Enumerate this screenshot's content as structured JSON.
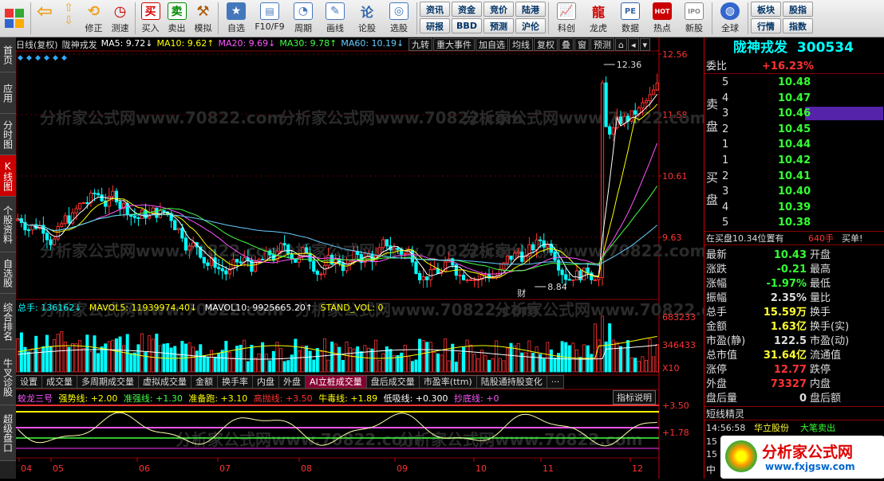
{
  "toolbar": {
    "buttons": [
      {
        "label": "",
        "icon": "back-icon",
        "color": "#f0a020"
      },
      {
        "label": "买入",
        "icon": "buy-icon",
        "color": "#d00",
        "glyph": "买"
      },
      {
        "label": "卖出",
        "icon": "sell-icon",
        "color": "#080",
        "glyph": "卖"
      },
      {
        "label": "模拟",
        "icon": "hammer-icon",
        "color": "#a50"
      },
      {
        "label": "自选",
        "icon": "star-icon",
        "color": "#36a"
      },
      {
        "label": "F10/F9",
        "icon": "f10-icon",
        "color": "#36a"
      },
      {
        "label": "周期",
        "icon": "period-icon",
        "color": "#36a"
      },
      {
        "label": "画线",
        "icon": "pencil-icon",
        "color": "#36a"
      },
      {
        "label": "论股",
        "icon": "discuss-icon",
        "color": "#36a"
      },
      {
        "label": "选股",
        "icon": "select-icon",
        "color": "#36a"
      }
    ],
    "updown": {
      "up_label": "修正",
      "down_label": "测速"
    },
    "pair_buttons": [
      [
        "资讯",
        "研报"
      ],
      [
        "资金",
        "BBD"
      ],
      [
        "竞价",
        "预测"
      ],
      [
        "陆港",
        "沪伦"
      ]
    ],
    "right_buttons": [
      {
        "label": "科创",
        "icon": "chart-icon"
      },
      {
        "label": "龙虎",
        "icon": "dragon-icon"
      },
      {
        "label": "数据",
        "icon": "pe-icon",
        "glyph": "PE"
      },
      {
        "label": "热点",
        "icon": "hot-icon",
        "glyph": "HOT"
      },
      {
        "label": "新股",
        "icon": "ipo-icon",
        "glyph": "IPO"
      },
      {
        "label": "全球",
        "icon": "globe-icon"
      }
    ],
    "far_right": [
      [
        "板块",
        "股指"
      ],
      [
        "行情",
        "指数"
      ]
    ]
  },
  "left_tabs": [
    "首页",
    "应用",
    "分时图",
    "K线图",
    "个股资料",
    "自选股",
    "综合排名",
    "牛叉诊股",
    "超级盘口"
  ],
  "left_tab_active": 3,
  "kline": {
    "period_label": "日线(复权)",
    "stock_name": "陇神戎发",
    "ma5": "MA5: 9.72↓",
    "ma10": "MA10: 9.62↑",
    "ma20": "MA20: 9.69↓",
    "ma30": "MA30: 9.78↑",
    "ma60": "MA60: 10.19↓",
    "buttons": [
      "九转",
      "重大事件",
      "加自选",
      "均线",
      "复权",
      "叠",
      "窗",
      "预测"
    ],
    "price_ticks": [
      "12.56",
      "11.58",
      "10.61",
      "9.63"
    ],
    "high_label": "12.36",
    "low_label": "8.84",
    "fin_label": "财",
    "watermark": "分析家公式网www.70822.com"
  },
  "volume": {
    "total": "总手: 136162↓",
    "mavol5": "MAVOL5: 11939974.40↓",
    "mavol10": "MAVOL10: 9925665.20↑",
    "standvol": "STAND_VOL: 0",
    "ticks": [
      "683233",
      "346433"
    ],
    "unit": "X10"
  },
  "indicator_tabs": [
    "设置",
    "成交量",
    "多周期成交量",
    "虚拟成交量",
    "金额",
    "换手率",
    "内盘",
    "外盘",
    "AI立桩成交量",
    "盘后成交量",
    "市盈率(ttm)",
    "陆股通持股变化",
    "···"
  ],
  "indicator_tab_active": 8,
  "indicator": {
    "name": "蛟龙三号",
    "strong": "强势线: +2.00",
    "quasi": "准强线: +1.30",
    "prep": "准备跑: +3.10",
    "high": "高抛线: +3.50",
    "bull": "牛毒线: +1.89",
    "low": "低吸线: +0.300",
    "bottom": "抄底线: +0",
    "button": "指标说明",
    "ticks": [
      "+3.50",
      "+1.78"
    ]
  },
  "months": [
    "04",
    "05",
    "06",
    "07",
    "08",
    "09",
    "10",
    "11",
    "12"
  ],
  "quote": {
    "name": "陇神戎发",
    "code": "300534",
    "weibi_label": "委比",
    "weibi_value": "+16.23%",
    "sell_label": [
      "卖",
      "盘"
    ],
    "buy_label": [
      "买",
      "盘"
    ],
    "sell": [
      {
        "lvl": "5",
        "price": "10.48"
      },
      {
        "lvl": "4",
        "price": "10.47"
      },
      {
        "lvl": "3",
        "price": "10.46"
      },
      {
        "lvl": "2",
        "price": "10.45"
      },
      {
        "lvl": "1",
        "price": "10.44"
      }
    ],
    "buy": [
      {
        "lvl": "1",
        "price": "10.42"
      },
      {
        "lvl": "2",
        "price": "10.41"
      },
      {
        "lvl": "3",
        "price": "10.40"
      },
      {
        "lvl": "4",
        "price": "10.39"
      },
      {
        "lvl": "5",
        "price": "10.38"
      }
    ],
    "position_text": "在买盘10.34位置有",
    "position_qty": "640手",
    "position_tag": "买单!",
    "stats": [
      {
        "l": "最新",
        "v": "10.43",
        "vc": "green",
        "r": "开盘"
      },
      {
        "l": "涨跌",
        "v": "-0.21",
        "vc": "green",
        "r": "最高"
      },
      {
        "l": "涨幅",
        "v": "-1.97%",
        "vc": "green",
        "r": "最低"
      },
      {
        "l": "振幅",
        "v": "2.35%",
        "vc": "white",
        "r": "量比"
      },
      {
        "l": "总手",
        "v": "15.59万",
        "vc": "yellow",
        "r": "换手"
      },
      {
        "l": "金额",
        "v": "1.63亿",
        "vc": "yellow",
        "r": "换手(实)"
      },
      {
        "l": "市盈(静)",
        "v": "122.5",
        "vc": "white",
        "r": "市盈(动)"
      },
      {
        "l": "总市值",
        "v": "31.64亿",
        "vc": "yellow",
        "r": "流通值"
      },
      {
        "l": "涨停",
        "v": "12.77",
        "vc": "red",
        "r": "跌停"
      },
      {
        "l": "外盘",
        "v": "73327",
        "vc": "red",
        "r": "内盘"
      },
      {
        "l": "盘后量",
        "v": "0",
        "vc": "white",
        "r": "盘后额"
      }
    ],
    "short_title": "短线精灵",
    "short_row": {
      "time": "14:56:58",
      "stock": "华立股份",
      "event": "大笔卖出"
    },
    "short_more": [
      "15",
      "15"
    ],
    "bottom_char": "中",
    "logo_text": "分析家公式网",
    "logo_url": "www.fxjgsw.com"
  }
}
